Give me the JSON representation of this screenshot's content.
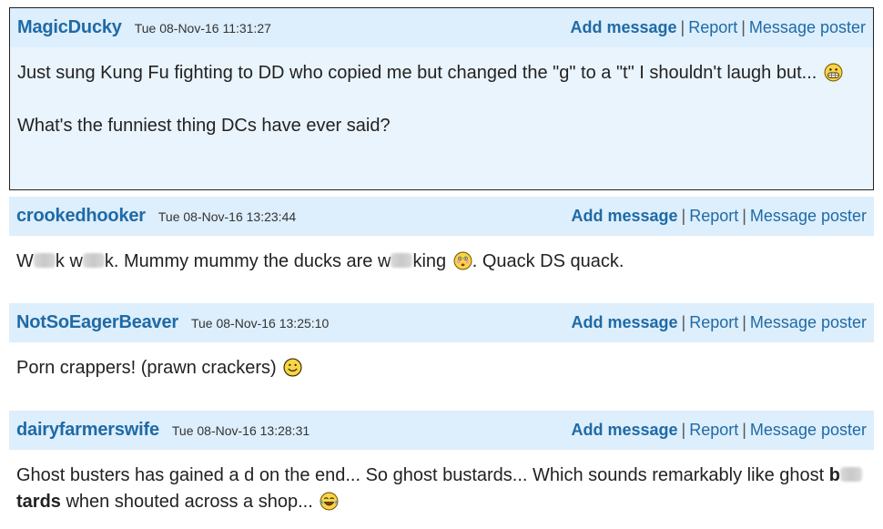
{
  "actions": {
    "add_message": "Add message",
    "report": "Report",
    "message_poster": "Message poster",
    "separator": "|"
  },
  "posts": [
    {
      "poster": "MagicDucky",
      "timestamp": "Tue 08-Nov-16 11:31:27",
      "line1": "Just sung Kung Fu fighting to DD who copied me but changed the \"g\" to a \"t\" I shouldn't laugh but...",
      "line1_emoji": "grinning-face-icon",
      "line2": "What's the funniest thing DCs have ever said?"
    },
    {
      "poster": "crookedhooker",
      "timestamp": "Tue 08-Nov-16 13:23:44",
      "w1a": "W",
      "w1b": "k",
      "w2a": "w",
      "w2b": "k. Mummy mummy the ducks are",
      "w3a": "w",
      "w3b": "king",
      "after_emoji": ". Quack DS quack.",
      "emoji": "flushed-face-icon"
    },
    {
      "poster": "NotSoEagerBeaver",
      "timestamp": "Tue 08-Nov-16 13:25:10",
      "text": "Porn crappers! (prawn crackers)",
      "emoji": "smiley-face-icon"
    },
    {
      "poster": "dairyfarmerswife",
      "timestamp": "Tue 08-Nov-16 13:28:31",
      "text_a": "Ghost busters has gained a d on the end... So ghost bustards... Which sounds remarkably like ghost",
      "bold_a": "b",
      "bold_b": "tards",
      "text_b": "when shouted across a shop...",
      "emoji": "laughing-tears-icon"
    }
  ]
}
